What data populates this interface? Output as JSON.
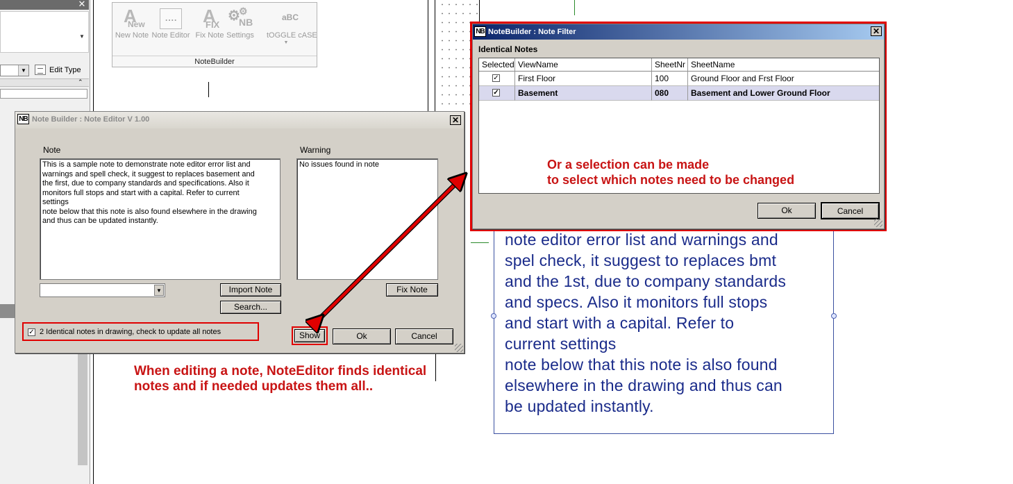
{
  "left_panel": {
    "edit_type_label": "Edit Type",
    "close_glyph": "✕",
    "collapse_glyph": "⌃"
  },
  "ribbon": {
    "panel_label": "NoteBuilder",
    "buttons": [
      {
        "label": "New Note",
        "icon": "new-note-icon",
        "icon_text": "A",
        "icon_sub": "New"
      },
      {
        "label": "Note Editor",
        "icon": "note-editor-icon"
      },
      {
        "label": "Fix Note",
        "icon": "fix-note-icon",
        "icon_text": "A",
        "icon_sub": "FIX"
      },
      {
        "label": "Settings",
        "icon": "settings-icon",
        "icon_sub": "NB"
      },
      {
        "label": "tOGGLE cASE",
        "icon": "toggle-case-icon",
        "icon_text": "aBC"
      }
    ]
  },
  "note_editor": {
    "icon_text": "NB",
    "title": "Note Builder : Note Editor V 1.00",
    "note_label": "Note",
    "note_text": "This is a sample note to demonstrate note editor error list and\nwarnings and spell check, it suggest to replaces basement and\nthe first, due to company standards and specifications. Also it\nmonitors full stops and start with a capital. Refer to current\nsettings\nnote below that this note is also found elsewhere in the drawing\nand thus can be updated instantly.",
    "warning_label": "Warning",
    "warning_text": "No issues found in note",
    "combo_value": "",
    "import_button": "Import Note",
    "search_button": "Search...",
    "fix_button": "Fix Note",
    "identical_checkbox_label": "2 Identical notes in drawing, check to update all notes",
    "identical_checked": true,
    "show_button": "Show",
    "ok_button": "Ok",
    "cancel_button": "Cancel"
  },
  "note_filter": {
    "icon_text": "NB",
    "title": "NoteBuilder : Note Filter",
    "section_label": "Identical Notes",
    "columns": [
      "Selected",
      "ViewName",
      "SheetNr",
      "SheetName"
    ],
    "rows": [
      {
        "selected": true,
        "view": "First Floor",
        "sheet_nr": "100",
        "sheet_name": "Ground Floor and Frst Floor",
        "highlight": false
      },
      {
        "selected": true,
        "view": "Basement",
        "sheet_nr": "080",
        "sheet_name": "Basement and Lower Ground Floor",
        "highlight": true
      }
    ],
    "ok_button": "Ok",
    "cancel_button": "Cancel"
  },
  "annotations": {
    "filter_caption_1": "Or a selection can be made",
    "filter_caption_2": "to select which notes need to be changed",
    "editor_caption_1": "When editing a note, NoteEditor finds identical",
    "editor_caption_2": "notes and if needed updates them all.."
  },
  "canvas_note": {
    "text": "note editor error list and warnings and\nspel check, it suggest to replaces bmt\nand the 1st, due to company standards\nand specs. Also it monitors full stops\nand start with a capital. Refer to\ncurrent settings\nnote below that this note is also found\nelsewhere in the drawing and thus can\nbe updated instantly."
  },
  "colors": {
    "annotation_red": "#c81414",
    "highlight_frame": "#e00000",
    "canvas_text_blue": "#1a2b8a",
    "titlebar_active": "#0a246a"
  }
}
